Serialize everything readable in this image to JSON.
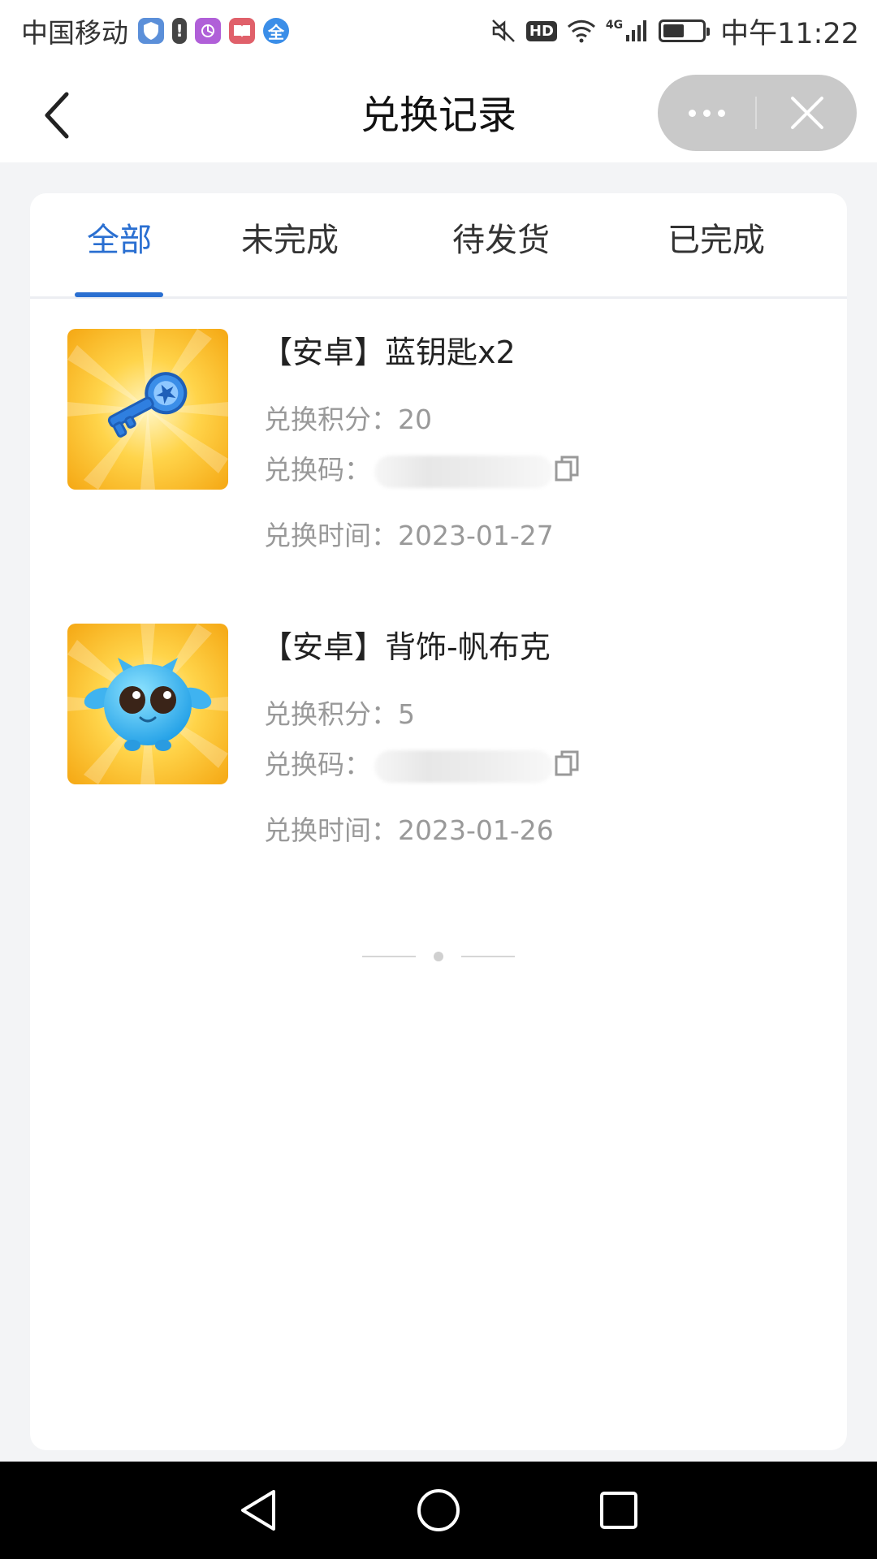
{
  "status_bar": {
    "carrier": "中国移动",
    "hd": "HD",
    "network": "4G",
    "battery_level": 0.55,
    "time": "中午11:22"
  },
  "nav": {
    "title": "兑换记录"
  },
  "tabs": [
    {
      "label": "全部",
      "active": true
    },
    {
      "label": "未完成",
      "active": false
    },
    {
      "label": "待发货",
      "active": false
    },
    {
      "label": "已完成",
      "active": false
    }
  ],
  "records": [
    {
      "title": "【安卓】蓝钥匙x2",
      "points_label": "兑换积分：",
      "points": "20",
      "code_label": "兑换码：",
      "time_label": "兑换时间：",
      "time": "2023-01-27",
      "icon": "blue-key-icon"
    },
    {
      "title": "【安卓】背饰-帆布克",
      "points_label": "兑换积分：",
      "points": "5",
      "code_label": "兑换码：",
      "time_label": "兑换时间：",
      "time": "2023-01-26",
      "icon": "blue-creature-icon"
    }
  ],
  "colors": {
    "accent": "#2a6fd1",
    "page_bg": "#f3f4f6",
    "muted_text": "#999999",
    "thumb_bg": "#f7b81f"
  }
}
